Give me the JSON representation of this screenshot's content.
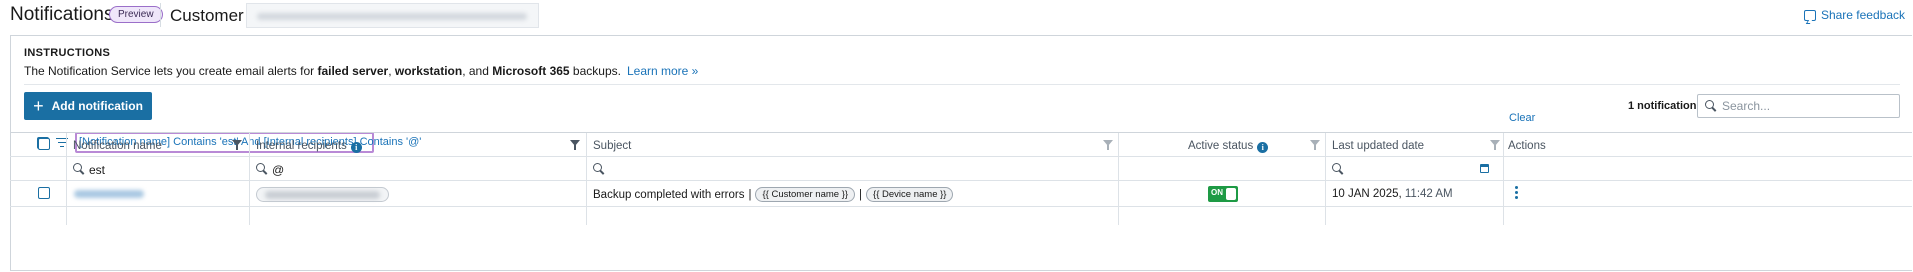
{
  "header": {
    "title": "Notifications",
    "badge": "Preview",
    "customer_label": "Customer",
    "feedback_label": "Share feedback"
  },
  "instructions": {
    "heading": "INSTRUCTIONS",
    "text_before": "The Notification Service lets you create email alerts for ",
    "bold_1": "failed server",
    "sep_1": ", ",
    "bold_2": "workstation",
    "sep_2": ", and ",
    "bold_3": "Microsoft 365",
    "text_after": " backups.",
    "learn_more": "Learn more »"
  },
  "toolbar": {
    "add_button": "Add notification",
    "count": "1 notifications",
    "search_placeholder": "Search..."
  },
  "filter": {
    "expression": "[Notification name] Contains 'est' And [Internal recipients] Contains '@'",
    "clear": "Clear"
  },
  "table": {
    "columns": [
      {
        "label": "Notification name"
      },
      {
        "label": "Internal recipients"
      },
      {
        "label": "Subject"
      },
      {
        "label": "Active status"
      },
      {
        "label": "Last updated date"
      },
      {
        "label": "Actions"
      }
    ],
    "filters": {
      "name": "est",
      "recipients": "@"
    },
    "rows": [
      {
        "subject_text": "Backup completed with errors",
        "pipe": "|",
        "token_1": "{{ Customer name }}",
        "token_2": "{{ Device name }}",
        "status": "ON",
        "date": "10 JAN 2025,",
        "time": "11:42 AM"
      }
    ]
  },
  "colors": {
    "accent": "#1a6fa3",
    "link": "#1a73b8",
    "toggle_on": "#1e9a45",
    "badge_border": "#9b6fc9"
  }
}
